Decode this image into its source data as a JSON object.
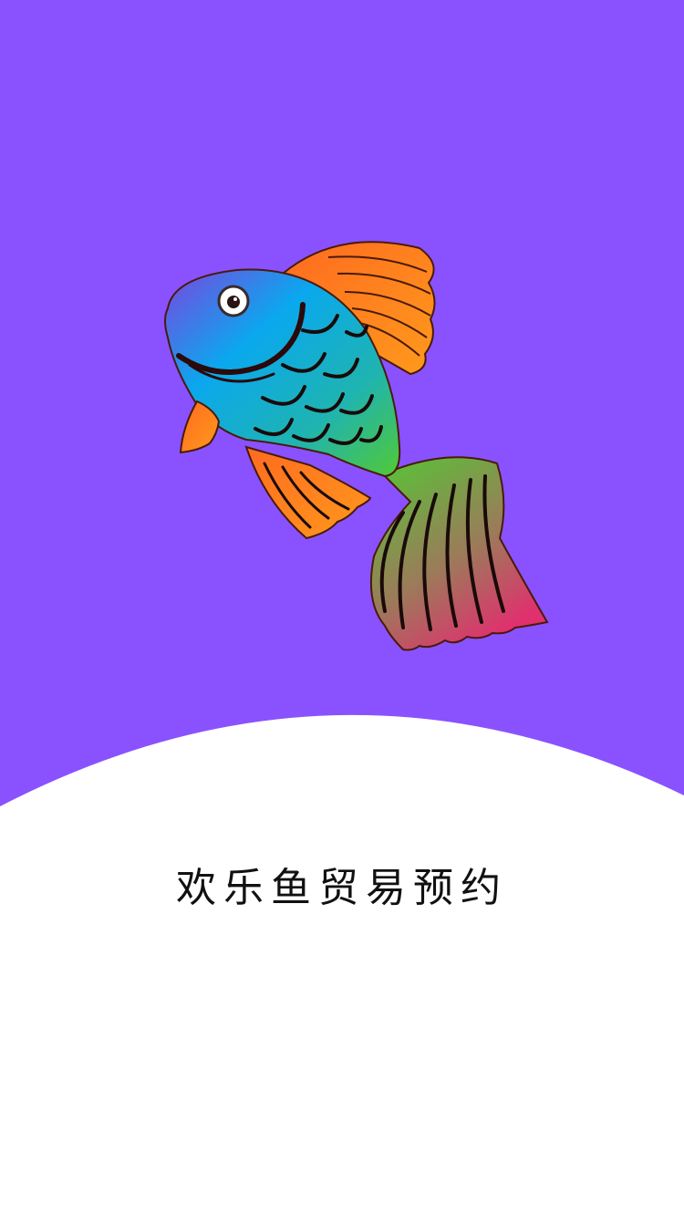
{
  "app": {
    "title": "欢乐鱼贸易预约"
  },
  "colors": {
    "background_top": "#8A52FE",
    "background_bottom": "#FFFFFF",
    "title_text": "#111111",
    "fish_body_start": "#7B45E0",
    "fish_body_mid": "#0AA8EE",
    "fish_body_end": "#52C934",
    "fin": "#FF8A1C",
    "tail_end": "#E0306E"
  },
  "illustration": {
    "icon": "fish-icon"
  }
}
